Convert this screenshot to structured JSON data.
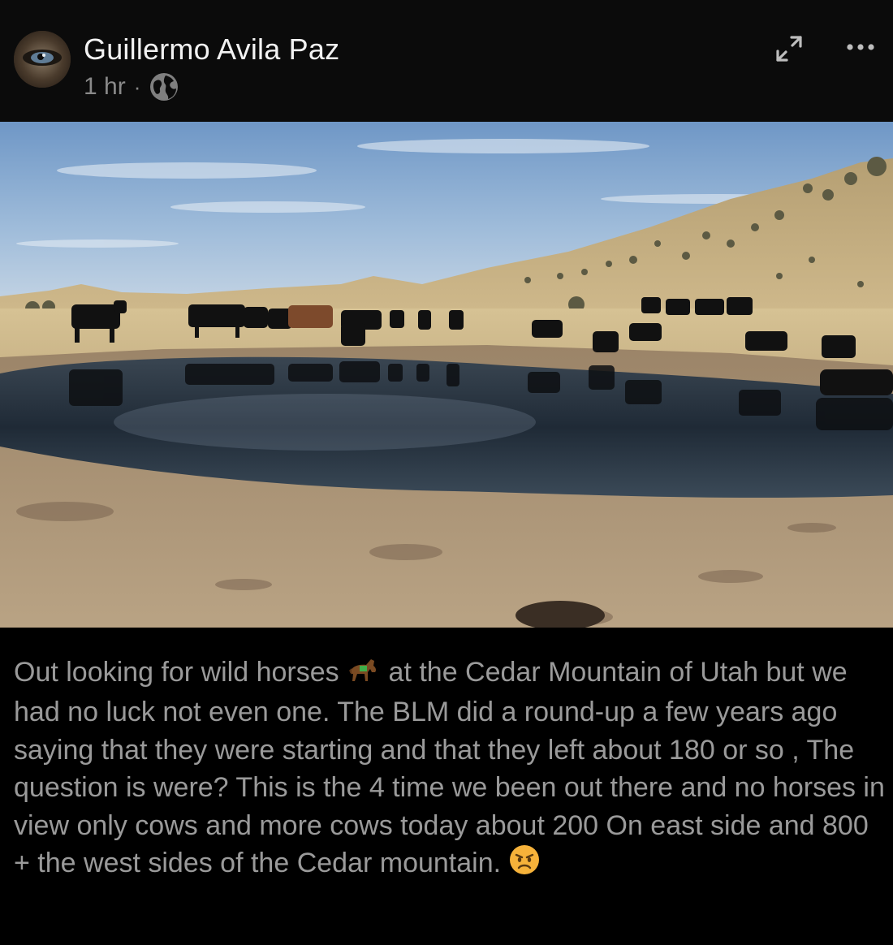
{
  "post": {
    "author_name": "Guillermo Avila Paz",
    "time": "1 hr",
    "separator": "·",
    "privacy_icon": "globe-icon",
    "actions": {
      "expand_icon": "expand-icon",
      "more_icon": "more-options-icon"
    },
    "text_part1": "Out looking for wild horses",
    "text_part2": " at the Cedar Mountain of Utah but we had no luck not even one. The BLM did a round-up a few years ago saying that they were starting and that they left about 180 or so , The question is were? This is the 4 time we been out there and no horses in view only cows and more cows today about 200 On east side  and 800 + the west sides of the Cedar mountain.",
    "emoji_horse": "horse-emoji",
    "emoji_angry": "angry-face-emoji"
  },
  "colors": {
    "header_bg": "#0b0b0b",
    "text_muted": "#9a9a9a",
    "name": "#f2f2f2"
  }
}
